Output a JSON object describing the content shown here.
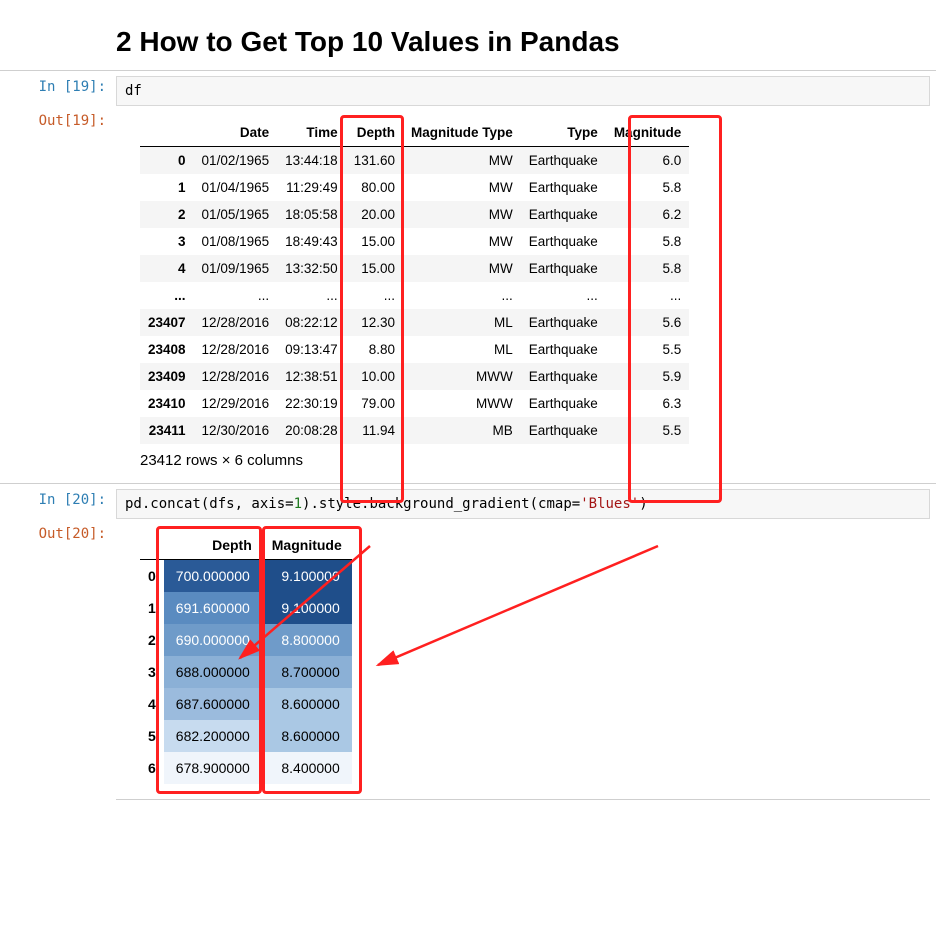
{
  "heading": "2  How to Get Top 10 Values in Pandas",
  "cell1": {
    "in_prompt": "In [19]:",
    "out_prompt": "Out[19]:",
    "code": "df",
    "headers": [
      "",
      "Date",
      "Time",
      "Depth",
      "Magnitude Type",
      "Type",
      "Magnitude"
    ],
    "rows": [
      {
        "idx": "0",
        "date": "01/02/1965",
        "time": "13:44:18",
        "depth": "131.60",
        "mt": "MW",
        "type": "Earthquake",
        "mag": "6.0"
      },
      {
        "idx": "1",
        "date": "01/04/1965",
        "time": "11:29:49",
        "depth": "80.00",
        "mt": "MW",
        "type": "Earthquake",
        "mag": "5.8"
      },
      {
        "idx": "2",
        "date": "01/05/1965",
        "time": "18:05:58",
        "depth": "20.00",
        "mt": "MW",
        "type": "Earthquake",
        "mag": "6.2"
      },
      {
        "idx": "3",
        "date": "01/08/1965",
        "time": "18:49:43",
        "depth": "15.00",
        "mt": "MW",
        "type": "Earthquake",
        "mag": "5.8"
      },
      {
        "idx": "4",
        "date": "01/09/1965",
        "time": "13:32:50",
        "depth": "15.00",
        "mt": "MW",
        "type": "Earthquake",
        "mag": "5.8"
      },
      {
        "idx": "...",
        "date": "...",
        "time": "...",
        "depth": "...",
        "mt": "...",
        "type": "...",
        "mag": "..."
      },
      {
        "idx": "23407",
        "date": "12/28/2016",
        "time": "08:22:12",
        "depth": "12.30",
        "mt": "ML",
        "type": "Earthquake",
        "mag": "5.6"
      },
      {
        "idx": "23408",
        "date": "12/28/2016",
        "time": "09:13:47",
        "depth": "8.80",
        "mt": "ML",
        "type": "Earthquake",
        "mag": "5.5"
      },
      {
        "idx": "23409",
        "date": "12/28/2016",
        "time": "12:38:51",
        "depth": "10.00",
        "mt": "MWW",
        "type": "Earthquake",
        "mag": "5.9"
      },
      {
        "idx": "23410",
        "date": "12/29/2016",
        "time": "22:30:19",
        "depth": "79.00",
        "mt": "MWW",
        "type": "Earthquake",
        "mag": "6.3"
      },
      {
        "idx": "23411",
        "date": "12/30/2016",
        "time": "20:08:28",
        "depth": "11.94",
        "mt": "MB",
        "type": "Earthquake",
        "mag": "5.5"
      }
    ],
    "shape": "23412 rows × 6 columns"
  },
  "cell2": {
    "in_prompt": "In [20]:",
    "out_prompt": "Out[20]:",
    "code_parts": {
      "a": "pd.concat(dfs, axis",
      "eq1": "=",
      "n1": "1",
      "b": ").style.background_gradient(cmap",
      "eq2": "=",
      "s1": "'Blues'",
      "c": ")"
    },
    "headers": [
      "",
      "Depth",
      "Magnitude"
    ],
    "rows": [
      {
        "idx": "0",
        "depth": "700.000000",
        "depth_bg": "#2a5a97",
        "depth_dark": true,
        "mag": "9.100000",
        "mag_bg": "#1f4e8a",
        "mag_dark": true
      },
      {
        "idx": "1",
        "depth": "691.600000",
        "depth_bg": "#5a8bc0",
        "depth_dark": true,
        "mag": "9.100000",
        "mag_bg": "#1f4e8a",
        "mag_dark": true
      },
      {
        "idx": "2",
        "depth": "690.000000",
        "depth_bg": "#6f9bc9",
        "depth_dark": true,
        "mag": "8.800000",
        "mag_bg": "#6f9bc9",
        "mag_dark": true
      },
      {
        "idx": "3",
        "depth": "688.000000",
        "depth_bg": "#8bb0d6",
        "depth_dark": false,
        "mag": "8.700000",
        "mag_bg": "#8bb0d6",
        "mag_dark": false
      },
      {
        "idx": "4",
        "depth": "687.600000",
        "depth_bg": "#9bbbdd",
        "depth_dark": false,
        "mag": "8.600000",
        "mag_bg": "#aac8e4",
        "mag_dark": false
      },
      {
        "idx": "5",
        "depth": "682.200000",
        "depth_bg": "#c7dbef",
        "depth_dark": false,
        "mag": "8.600000",
        "mag_bg": "#aac8e4",
        "mag_dark": false
      },
      {
        "idx": "6",
        "depth": "678.900000",
        "depth_bg": "#f0f5fb",
        "depth_dark": false,
        "mag": "8.400000",
        "mag_bg": "#f0f5fb",
        "mag_dark": false
      }
    ]
  }
}
